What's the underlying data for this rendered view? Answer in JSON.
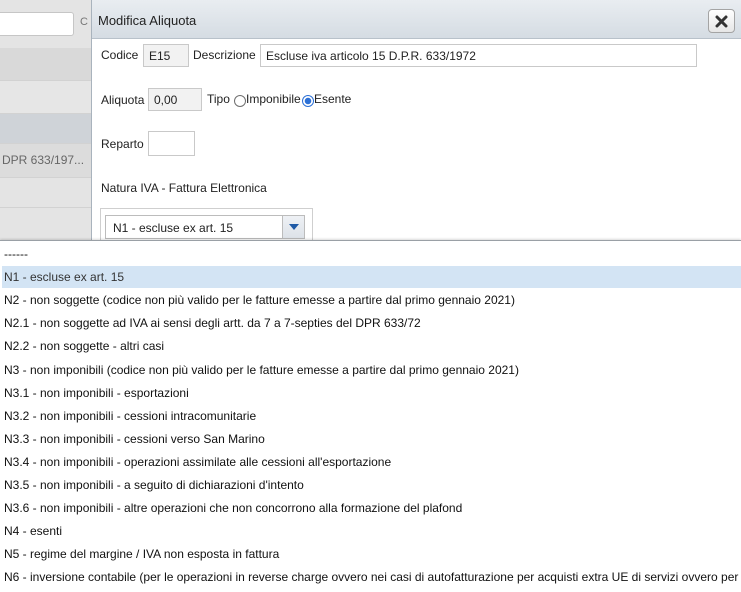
{
  "background": {
    "search_button_label": "C",
    "rows": [
      "",
      "DPR 633/197..."
    ]
  },
  "dialog": {
    "title": "Modifica Aliquota",
    "close_icon": "close-x-icon",
    "codice": {
      "label": "Codice",
      "value": "E15"
    },
    "descrizione": {
      "label": "Descrizione",
      "value": "Escluse iva articolo 15 D.P.R. 633/1972"
    },
    "aliquota": {
      "label": "Aliquota",
      "value": "0,00"
    },
    "tipo": {
      "label": "Tipo",
      "options": [
        {
          "label": "Imponibile",
          "selected": false
        },
        {
          "label": "Esente",
          "selected": true
        }
      ]
    },
    "reparto": {
      "label": "Reparto",
      "value": ""
    },
    "natura": {
      "label": "Natura IVA - Fattura Elettronica",
      "selected": "N1 - escluse ex art. 15"
    }
  },
  "dropdown": {
    "selected_index": 1,
    "options": [
      "------",
      "N1 - escluse ex art. 15",
      "N2 - non soggette (codice non più valido per le fatture emesse a partire dal primo gennaio 2021)",
      "N2.1 - non soggette ad IVA ai sensi degli artt. da 7 a 7-septies del DPR 633/72",
      "N2.2 - non soggette - altri casi",
      "N3 - non imponibili (codice non più valido per le fatture emesse a partire dal primo gennaio 2021)",
      "N3.1 - non imponibili - esportazioni",
      "N3.2 - non imponibili - cessioni intracomunitarie",
      "N3.3 - non imponibili - cessioni verso San Marino",
      "N3.4 - non imponibili - operazioni assimilate alle cessioni all'esportazione",
      "N3.5 - non imponibili - a seguito di dichiarazioni d'intento",
      "N3.6 - non imponibili - altre operazioni che non concorrono alla formazione del plafond",
      "N4 - esenti",
      "N5 - regime del margine / IVA non esposta in fattura",
      "N6 - inversione contabile (per le operazioni in reverse charge ovvero nei casi di autofatturazione per acquisti extra UE di servizi ovvero per"
    ]
  },
  "colors": {
    "selection": "#d3e4f4",
    "titlebar": "#dde3e9",
    "radio_accent": "#2c70d6"
  }
}
